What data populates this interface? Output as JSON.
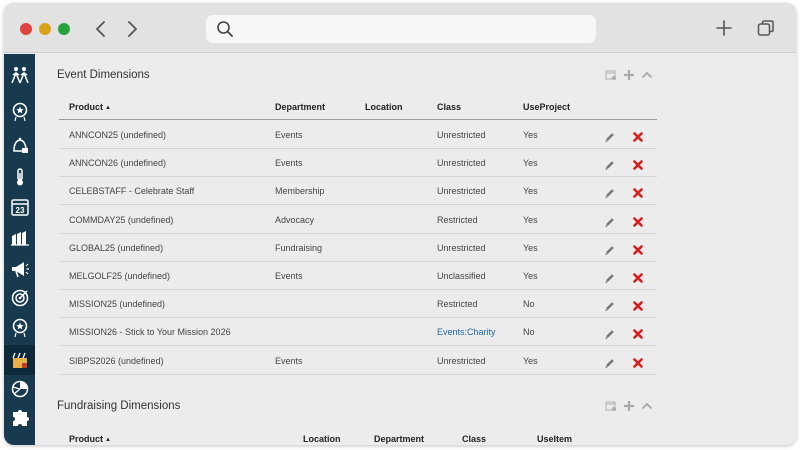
{
  "browser": {
    "back_icon": "chevron-left-icon",
    "forward_icon": "chevron-right-icon",
    "search_icon": "search-icon",
    "url_value": "",
    "new_tab_icon": "plus-icon",
    "tabs_icon": "tabs-icon"
  },
  "sidebar": {
    "items": [
      {
        "icon": "people-icon"
      },
      {
        "icon": "star-badge-icon"
      },
      {
        "icon": "bell-icon"
      },
      {
        "icon": "thermometer-icon"
      },
      {
        "icon": "calendar-icon",
        "text": "23"
      },
      {
        "icon": "chart-folder-icon"
      },
      {
        "icon": "megaphone-icon"
      },
      {
        "icon": "target-icon"
      },
      {
        "icon": "star-badge-icon"
      },
      {
        "icon": "clapperboard-icon",
        "active": true
      },
      {
        "icon": "pie-chart-icon"
      },
      {
        "icon": "puzzle-icon"
      }
    ]
  },
  "event_dimensions": {
    "title": "Event Dimensions",
    "columns": [
      "Product",
      "Department",
      "Location",
      "Class",
      "UseProject"
    ],
    "sort_indicator": "▲",
    "rows": [
      {
        "product": "ANNCON25 (undefined)",
        "department": "Events",
        "location": "",
        "class": "Unrestricted",
        "use_project": "Yes"
      },
      {
        "product": "ANNCON26 (undefined)",
        "department": "Events",
        "location": "",
        "class": "Unrestricted",
        "use_project": "Yes"
      },
      {
        "product": "CELEBSTAFF - Celebrate Staff",
        "department": "Membership",
        "location": "",
        "class": "Unrestricted",
        "use_project": "Yes"
      },
      {
        "product": "COMMDAY25 (undefined)",
        "department": "Advocacy",
        "location": "",
        "class": "Restricted",
        "use_project": "Yes"
      },
      {
        "product": "GLOBAL25 (undefined)",
        "department": "Fundraising",
        "location": "",
        "class": "Unrestricted",
        "use_project": "Yes"
      },
      {
        "product": "MELGOLF25 (undefined)",
        "department": "Events",
        "location": "",
        "class": "Unclassified",
        "use_project": "Yes"
      },
      {
        "product": "MISSION25 (undefined)",
        "department": "",
        "location": "",
        "class": "Restricted",
        "use_project": "No"
      },
      {
        "product": "MISSION26 - Stick to Your Mission 2026",
        "department": "",
        "location": "",
        "class": "Events:Charity",
        "use_project": "No",
        "class_is_link": true
      },
      {
        "product": "SIBPS2026 (undefined)",
        "department": "Events",
        "location": "",
        "class": "Unrestricted",
        "use_project": "Yes"
      }
    ]
  },
  "fundraising_dimensions": {
    "title": "Fundraising Dimensions",
    "columns": [
      "Product",
      "Location",
      "Department",
      "Class",
      "UseItem"
    ],
    "sort_indicator": "▲"
  },
  "colors": {
    "sidebar_bg": "#173a4e",
    "link": "#1e6aa0",
    "delete": "#d42020"
  }
}
